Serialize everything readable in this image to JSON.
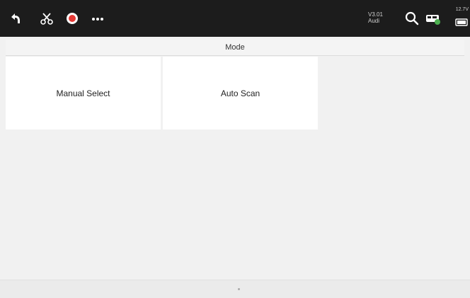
{
  "toolbar": {
    "icons": [
      "back-icon",
      "scissors-icon",
      "record-icon",
      "more-icon",
      "search-icon",
      "vehicle-connection-icon"
    ],
    "version_line1": "V3.01",
    "version_line2": "Audi",
    "battery_text": "12.7V"
  },
  "mode_bar": {
    "title": "Mode"
  },
  "tiles": [
    {
      "label": "Manual Select"
    },
    {
      "label": "Auto Scan"
    }
  ],
  "colors": {
    "toolbar_bg": "#1c1c1c",
    "page_bg": "#f1f1f1",
    "tile_bg": "#ffffff",
    "record_red": "#e53935",
    "connection_green": "#4caf50"
  }
}
